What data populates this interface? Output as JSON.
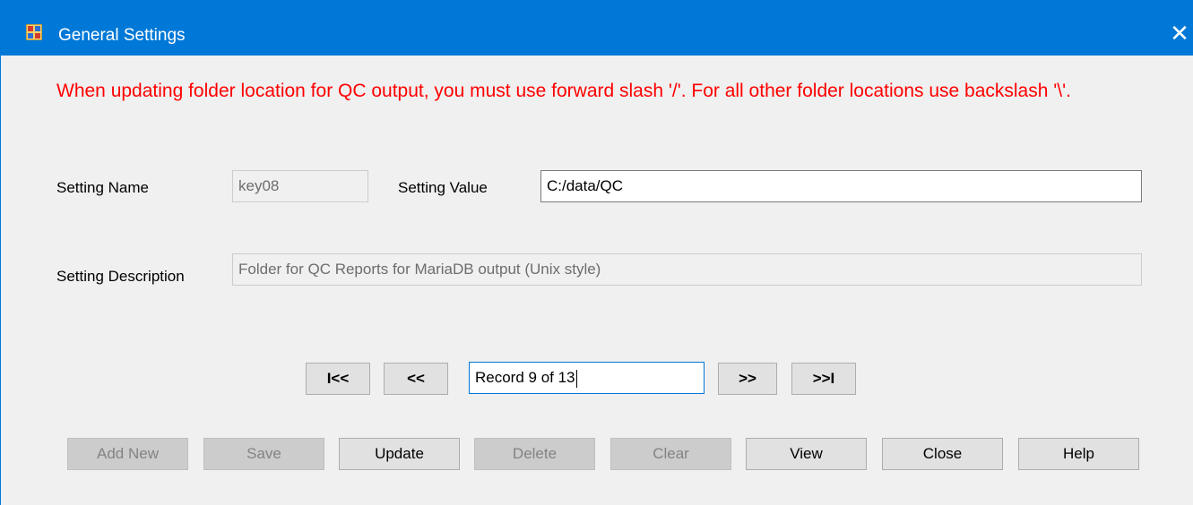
{
  "window": {
    "title": "General Settings",
    "close_glyph": "✕",
    "icon": "app-window-icon"
  },
  "warning_text": "When updating folder location for QC output, you must use forward slash '/'. For all other folder locations use backslash '\\'.",
  "form": {
    "setting_name_label": "Setting Name",
    "setting_name_value": "key08",
    "setting_value_label": "Setting Value",
    "setting_value_value": "C:/data/QC",
    "setting_description_label": "Setting Description",
    "setting_description_value": "Folder for QC Reports for MariaDB output (Unix style)"
  },
  "navigator": {
    "first_label": "I<<",
    "prev_label": "<<",
    "record_text": "Record 9 of 13",
    "next_label": ">>",
    "last_label": ">>I"
  },
  "actions": {
    "add_new": "Add New",
    "save": "Save",
    "update": "Update",
    "delete": "Delete",
    "clear": "Clear",
    "view": "View",
    "close": "Close",
    "help": "Help"
  },
  "colors": {
    "titlebar": "#0078d7",
    "warning": "#ff0000",
    "background": "#f0f0f0"
  }
}
